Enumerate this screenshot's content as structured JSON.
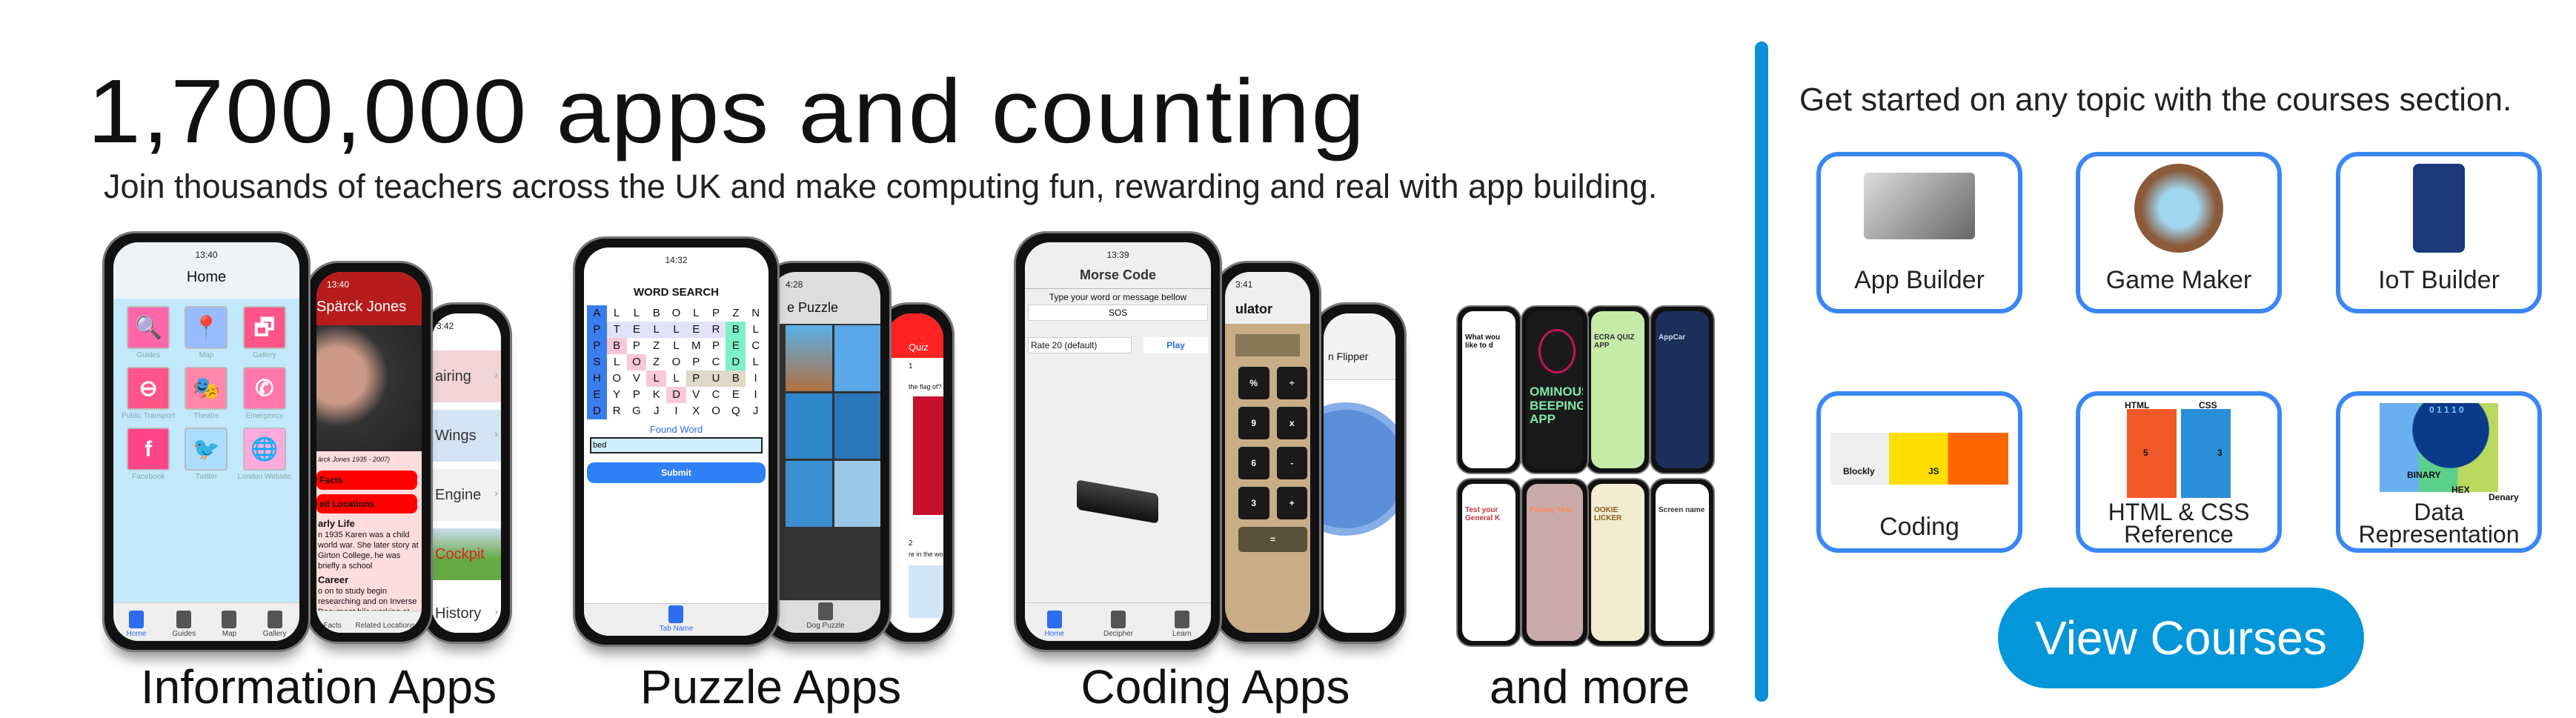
{
  "hero": {
    "title": "1,700,000 apps and counting",
    "subtitle": "Join thousands of teachers across the UK and make computing fun, rewarding and real with app building."
  },
  "captions": [
    "Information Apps",
    "Puzzle Apps",
    "Coding Apps",
    "and more"
  ],
  "info": {
    "home": {
      "time": "13:40",
      "title": "Home",
      "icons": [
        {
          "label": "Guides",
          "icon": "magnifier-icon",
          "glyph": "🔍"
        },
        {
          "label": "Map",
          "icon": "map-pin-icon",
          "glyph": "📍"
        },
        {
          "label": "Gallery",
          "icon": "gallery-icon",
          "glyph": "🗗"
        },
        {
          "label": "Public Transport",
          "icon": "underground-icon",
          "glyph": "⊖"
        },
        {
          "label": "Theatre",
          "icon": "theatre-masks-icon",
          "glyph": "🎭"
        },
        {
          "label": "Emergency",
          "icon": "phone-icon",
          "glyph": "✆"
        },
        {
          "label": "Facebook",
          "icon": "facebook-icon",
          "glyph": "f"
        },
        {
          "label": "Twitter",
          "icon": "twitter-icon",
          "glyph": "🐦"
        },
        {
          "label": "London Website",
          "icon": "globe-icon",
          "glyph": "🌐"
        }
      ],
      "tabs": [
        "Home",
        "Guides",
        "Map",
        "Gallery"
      ]
    },
    "bio": {
      "time": "13:40",
      "title": "Spärck Jones",
      "caption": "ärck Jones 1935 - 2007)",
      "btn1": "Facts",
      "btn2": "ed Locations",
      "h1": "arly Life",
      "p1": "n 1935 Karen was a child world war. She later story at Girton College, he was briefly a school",
      "h2": "Career",
      "p2": "o on to study begin researching and on Inverse Document hile working at sity Computer",
      "tabs": [
        "Facts",
        "Related Locations"
      ]
    },
    "plane": {
      "time": "3:42",
      "items": [
        "airing",
        "Wings",
        "Engine",
        "Cockpit",
        "History"
      ]
    }
  },
  "puzzle": {
    "word": {
      "time": "14:32",
      "title": "WORD SEARCH",
      "grid": [
        "ALLBOLPZN",
        "PTELLERBL",
        "PBPZLMPEC",
        "SLOZOPCDL",
        "HOVLLPUBI",
        "EYPKDVCEI",
        "DRGJIXOQJ"
      ],
      "found_label": "Found Word",
      "input_value": "bed",
      "submit": "Submit",
      "tab": "Tab Name"
    },
    "dog": {
      "time": "4:28",
      "title": "e Puzzle",
      "tab": "Dog Puzzle"
    },
    "quiz": {
      "title": "Quiz",
      "q1": "1",
      "q1_text": "the flag of?",
      "q2": "2",
      "q2_text": "re in the world?"
    }
  },
  "coding": {
    "morse": {
      "time": "13:39",
      "title": "Morse Code",
      "prompt": "Type your word or message bellow",
      "input_value": "SOS",
      "rate": "Rate 20 (default)",
      "play": "Play",
      "tabs": [
        "Home",
        "Decipher",
        "Learn"
      ]
    },
    "calc": {
      "time": "3:41",
      "title": "ulator",
      "keys": [
        "%",
        "÷",
        "9",
        "x",
        "6",
        "-",
        "3",
        "+",
        "="
      ]
    },
    "coin": {
      "title": "n Flipper"
    }
  },
  "more": {
    "apps": [
      {
        "text": "What wou like to d",
        "bg": "#ffffff",
        "fg": "#111111"
      },
      {
        "text": "OMINOUS BEEPING APP",
        "bg": "#1a1a1a",
        "fg": "#7ee8a8"
      },
      {
        "text": "ECRA QUIZ APP",
        "bg": "#c6eaa8",
        "fg": "#333333"
      },
      {
        "text": "AppCar",
        "bg": "#1c2f5a",
        "fg": "#cfd8ee"
      },
      {
        "text": "Test your General K",
        "bg": "#ffffff",
        "fg": "#c33333"
      },
      {
        "text": "Pairing Test",
        "bg": "#c9aaa8",
        "fg": "#ff8855"
      },
      {
        "text": "OOKIE LICKER",
        "bg": "#f4ecd0",
        "fg": "#8a5a22"
      },
      {
        "text": "Screen name",
        "bg": "#ffffff",
        "fg": "#333333"
      }
    ]
  },
  "courses": {
    "heading": "Get started on any topic with the courses section.",
    "items": [
      {
        "label": "App Builder",
        "icon": "devices-icon"
      },
      {
        "label": "Game Maker",
        "icon": "phaser-logo-icon"
      },
      {
        "label": "IoT Builder",
        "icon": "circuit-board-icon"
      },
      {
        "label": "Coding",
        "icon": "code-editors-icon",
        "sub": [
          "Blockly",
          "JS"
        ]
      },
      {
        "label": "HTML & CSS",
        "label2": "Reference",
        "icon": "html-css-icon",
        "sub": [
          "HTML",
          "CSS",
          "5",
          "3"
        ]
      },
      {
        "label": "Data",
        "label2": "Representation",
        "icon": "data-files-icon",
        "sub": [
          "0 1 1 1 0",
          "BINARY",
          "HEX",
          "Denary"
        ]
      }
    ],
    "button": "View Courses"
  },
  "colors": {
    "accent": "#0396d9",
    "card_border": "#3a86f4",
    "divider": "#0a8fd8"
  }
}
